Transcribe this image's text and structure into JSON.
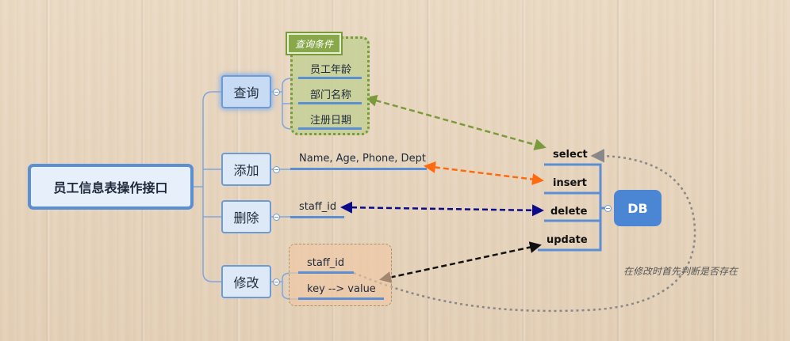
{
  "root": {
    "label": "员工信息表操作接口"
  },
  "operations": [
    {
      "label": "查询"
    },
    {
      "label": "添加"
    },
    {
      "label": "删除"
    },
    {
      "label": "修改"
    }
  ],
  "query": {
    "group_title": "查询条件",
    "conditions": [
      "员工年龄",
      "部门名称",
      "注册日期"
    ]
  },
  "add": {
    "fields": "Name, Age, Phone, Dept"
  },
  "delete": {
    "key": "staff_id"
  },
  "modify": {
    "items": [
      "staff_id",
      "key --> value"
    ]
  },
  "db": {
    "label": "DB",
    "operations": [
      "select",
      "insert",
      "delete",
      "update"
    ]
  },
  "note": "在修改时首先判断是否存在",
  "colors": {
    "node_border": "#5a8fd3",
    "db_fill": "#4a86d4",
    "query_arrow": "#7a9a3c",
    "add_arrow": "#ff6a10",
    "delete_arrow": "#0a0a8a",
    "modify_arrow": "#111111",
    "note_arrow": "#888888"
  }
}
